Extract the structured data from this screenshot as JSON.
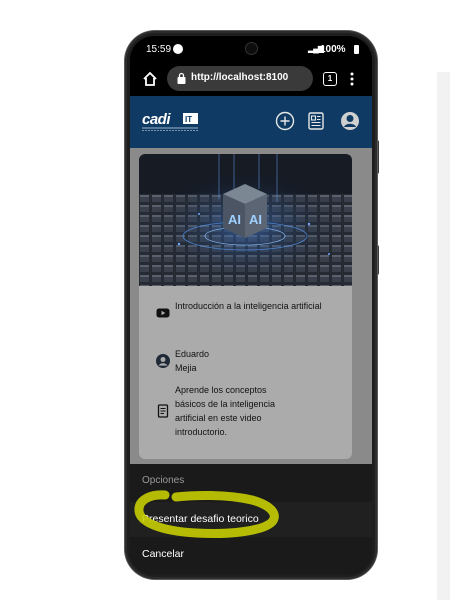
{
  "status_bar": {
    "time": "15:59",
    "battery": "100%"
  },
  "browser": {
    "url": "http://localhost:8100",
    "tab_count": "1"
  },
  "header": {
    "logo_alt": "Academia de Software"
  },
  "card": {
    "title": "Introducción a la inteligencia artificial",
    "author_first": "Eduardo",
    "author_last": "Mejia",
    "description": "Aprende los conceptos básicos de la inteligencia artificial en este video introductorio.",
    "image_badge": "AI"
  },
  "action_sheet": {
    "header": "Opciones",
    "items": [
      {
        "label": "Presentar desafio teorico"
      },
      {
        "label": "Cancelar"
      }
    ]
  },
  "colors": {
    "header_bg": "#0f3a63",
    "highlight": "#c7cd00",
    "sheet_bg": "#1a1a1a"
  },
  "icons": [
    "home-icon",
    "lock-icon",
    "tabs-icon",
    "menu-icon",
    "add-circle-icon",
    "newspaper-icon",
    "user-icon",
    "youtube-icon",
    "person-icon",
    "document-icon"
  ]
}
